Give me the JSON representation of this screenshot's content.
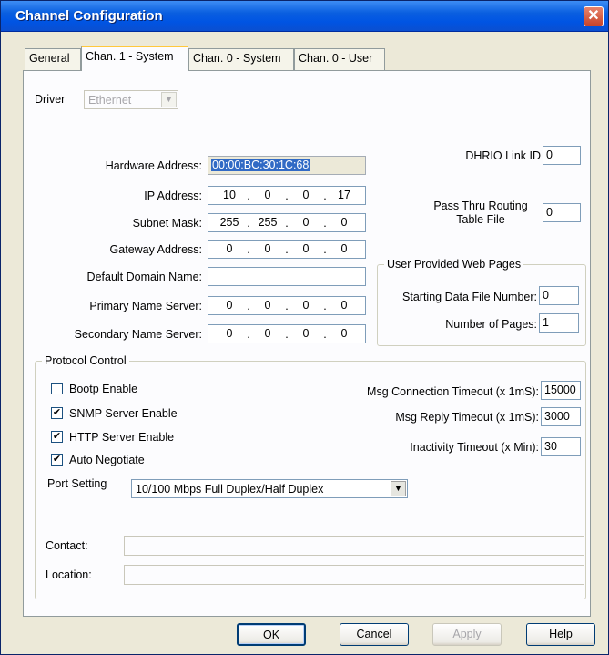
{
  "window": {
    "title": "Channel Configuration"
  },
  "tabs": [
    {
      "label": "General"
    },
    {
      "label": "Chan. 1 - System"
    },
    {
      "label": "Chan. 0 - System"
    },
    {
      "label": "Chan. 0 - User"
    }
  ],
  "driver": {
    "label": "Driver",
    "value": "Ethernet"
  },
  "network": {
    "hardware_address": {
      "label": "Hardware Address:",
      "value": "00:00:BC:30:1C:68"
    },
    "ip_address": {
      "label": "IP Address:",
      "octets": [
        "10",
        "0",
        "0",
        "17"
      ]
    },
    "subnet_mask": {
      "label": "Subnet Mask:",
      "octets": [
        "255",
        "255",
        "0",
        "0"
      ]
    },
    "gateway_address": {
      "label": "Gateway Address:",
      "octets": [
        "0",
        "0",
        "0",
        "0"
      ]
    },
    "default_domain_name": {
      "label": "Default Domain Name:",
      "value": ""
    },
    "primary_name_server": {
      "label": "Primary Name Server:",
      "octets": [
        "0",
        "0",
        "0",
        "0"
      ]
    },
    "secondary_name_server": {
      "label": "Secondary Name Server:",
      "octets": [
        "0",
        "0",
        "0",
        "0"
      ]
    }
  },
  "dhrio": {
    "label": "DHRIO Link ID",
    "value": "0"
  },
  "pass_thru": {
    "label_line1": "Pass Thru Routing",
    "label_line2": "Table File",
    "value": "0"
  },
  "web_pages": {
    "title": "User Provided Web Pages",
    "starting_file": {
      "label": "Starting Data File Number:",
      "value": "0"
    },
    "num_pages": {
      "label": "Number of Pages:",
      "value": "1"
    }
  },
  "protocol": {
    "title": "Protocol Control",
    "bootp": {
      "label": "Bootp Enable",
      "checked": false
    },
    "snmp": {
      "label": "SNMP Server Enable",
      "checked": true
    },
    "http": {
      "label": "HTTP Server Enable",
      "checked": true
    },
    "auto_neg": {
      "label": "Auto Negotiate",
      "checked": true
    },
    "msg_conn_timeout": {
      "label": "Msg Connection Timeout (x 1mS):",
      "value": "15000"
    },
    "msg_reply_timeout": {
      "label": "Msg Reply Timeout (x 1mS):",
      "value": "3000"
    },
    "inactivity_timeout": {
      "label": "Inactivity Timeout (x Min):",
      "value": "30"
    },
    "port_setting": {
      "label": "Port Setting",
      "value": "10/100 Mbps Full Duplex/Half Duplex"
    },
    "contact": {
      "label": "Contact:",
      "value": ""
    },
    "location": {
      "label": "Location:",
      "value": ""
    }
  },
  "glyphs": {
    "check": "✔",
    "close": "✕",
    "arrow": "▼"
  },
  "buttons": {
    "ok": "OK",
    "cancel": "Cancel",
    "apply": "Apply",
    "help": "Help"
  }
}
